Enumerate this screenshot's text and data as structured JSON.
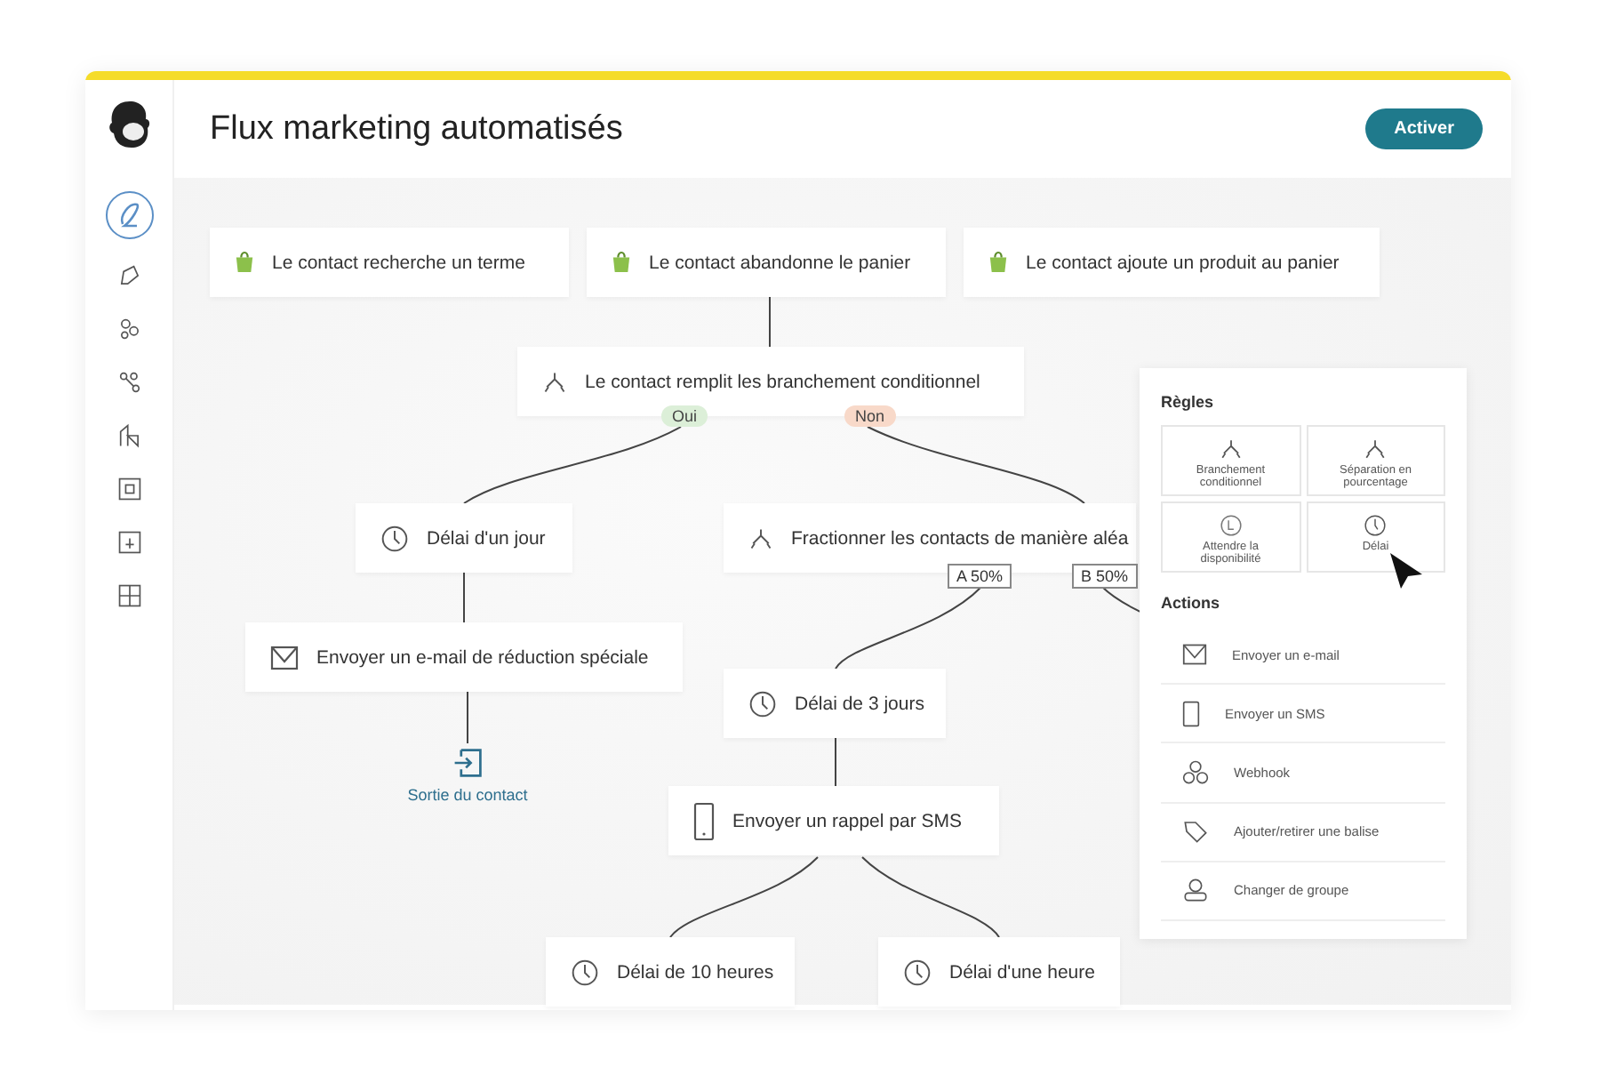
{
  "header": {
    "title": "Flux marketing automatisés",
    "button": "Activer"
  },
  "sidebar": {
    "items": [
      {
        "kind": "pen",
        "selected": true
      },
      {
        "kind": "tag",
        "selected": false
      },
      {
        "kind": "people",
        "selected": false
      },
      {
        "kind": "link",
        "selected": false
      },
      {
        "kind": "building",
        "selected": false
      },
      {
        "kind": "square",
        "selected": false
      },
      {
        "kind": "box",
        "selected": false
      },
      {
        "kind": "grid",
        "selected": false
      }
    ]
  },
  "flow": {
    "nodes": [
      {
        "kind": "trigger",
        "label": "Le contact recherche un terme"
      },
      {
        "kind": "trigger",
        "label": "Le contact abandonne le panier"
      },
      {
        "kind": "trigger",
        "label": "Le contact ajoute un produit au panier"
      },
      {
        "kind": "condition",
        "label": "Le contact remplit les branchement conditionnel",
        "branches": [
          {
            "label": "Oui",
            "color": "#dcefd8"
          },
          {
            "label": "Non",
            "color": "#f8d9c9"
          }
        ]
      },
      {
        "kind": "delay",
        "label": "Délai d'un jour"
      },
      {
        "kind": "split",
        "label": "Fractionner les contacts de manière aléa",
        "branches": [
          {
            "label": "A 50%"
          },
          {
            "label": "B 50%"
          }
        ]
      },
      {
        "kind": "email",
        "label": "Envoyer un e-mail de réduction spéciale"
      },
      {
        "kind": "delay",
        "label": "Délai de 3 jours"
      },
      {
        "kind": "sms",
        "label": "Envoyer un rappel par SMS"
      },
      {
        "kind": "delay",
        "label": "Délai de 10 heures"
      },
      {
        "kind": "delay",
        "label": "Délai d'une heure"
      }
    ],
    "exit": {
      "label": "Sortie du contact"
    }
  },
  "panel": {
    "rules_title": "Règles",
    "rules": [
      {
        "kind": "branch",
        "label": "Branchement conditionnel"
      },
      {
        "kind": "branch",
        "label": "Séparation en pourcentage"
      },
      {
        "kind": "wait",
        "label": "Attendre la disponibilité"
      },
      {
        "kind": "delay",
        "label": "Délai"
      }
    ],
    "actions_title": "Actions",
    "actions": [
      {
        "kind": "email",
        "label": "Envoyer un e-mail"
      },
      {
        "kind": "sms",
        "label": "Envoyer un SMS"
      },
      {
        "kind": "webhook",
        "label": "Webhook"
      },
      {
        "kind": "tag",
        "label": "Ajouter/retirer une balise"
      },
      {
        "kind": "group",
        "label": "Changer de groupe"
      }
    ]
  }
}
